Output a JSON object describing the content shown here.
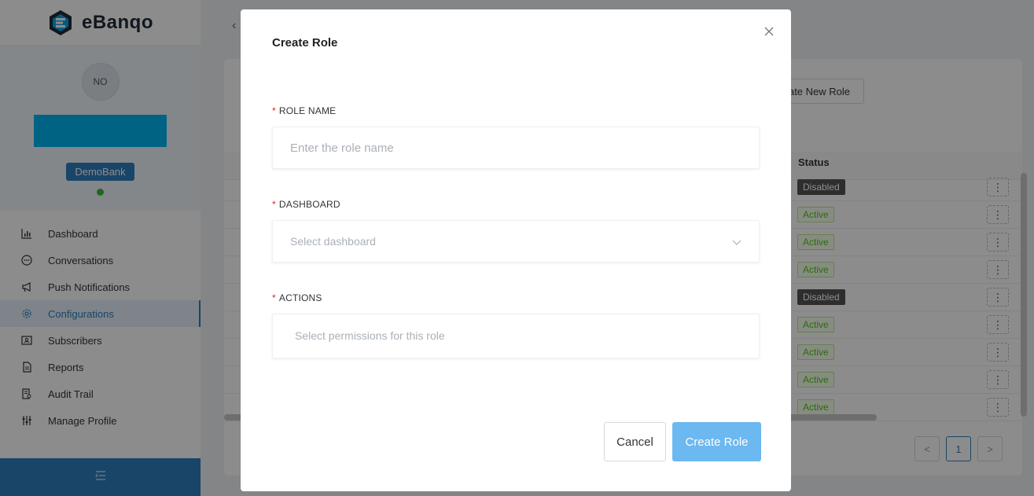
{
  "app": {
    "brand": "eBanqo"
  },
  "profile": {
    "initials": "NO",
    "bank": "DemoBank"
  },
  "sidebar": {
    "items": [
      {
        "label": "Dashboard",
        "icon": "bar-chart-icon"
      },
      {
        "label": "Conversations",
        "icon": "chat-icon"
      },
      {
        "label": "Push Notifications",
        "icon": "megaphone-icon"
      },
      {
        "label": "Configurations",
        "icon": "gear-icon",
        "active": true
      },
      {
        "label": "Subscribers",
        "icon": "contact-card-icon"
      },
      {
        "label": "Reports",
        "icon": "document-icon"
      },
      {
        "label": "Audit Trail",
        "icon": "audit-icon"
      },
      {
        "label": "Manage Profile",
        "icon": "sliders-icon"
      }
    ]
  },
  "background": {
    "new_role_button": "ate New Role",
    "status_header": "Status",
    "rows": [
      "Disabled",
      "Active",
      "Active",
      "Active",
      "Disabled",
      "Active",
      "Active",
      "Active",
      "Active"
    ],
    "pagination": {
      "prev": "<",
      "current": "1",
      "next": ">"
    }
  },
  "modal": {
    "title": "Create Role",
    "role_name": {
      "label": "ROLE NAME",
      "placeholder": "Enter the role name",
      "value": ""
    },
    "dashboard": {
      "label": "DASHBOARD",
      "placeholder": "Select dashboard"
    },
    "actions": {
      "label": "ACTIONS",
      "placeholder": "Select permissions for this role"
    },
    "required_marker": "*",
    "cancel_label": "Cancel",
    "create_label": "Create Role"
  },
  "colors": {
    "accent": "#2f7fbf",
    "name_bar": "#00b4f0",
    "create_button": "#6cb8f0",
    "required": "#e02424"
  }
}
